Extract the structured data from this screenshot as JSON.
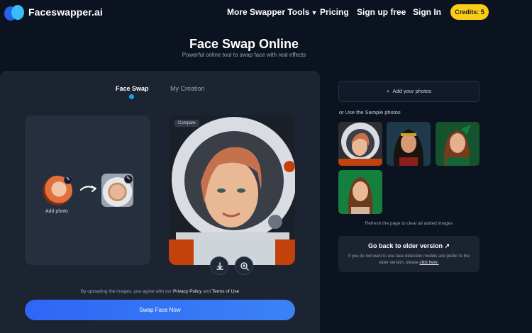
{
  "nav": {
    "brand": "Faceswapper.ai",
    "links": [
      "More Swapper Tools",
      "Pricing",
      "Sign up free",
      "Sign In"
    ],
    "credits": "Credits: 5"
  },
  "hero": {
    "title": "Face Swap Online",
    "subtitle": "Powerful online tool to swap face with real effects"
  },
  "tabs": {
    "active": "Face Swap",
    "other": "My Creation"
  },
  "upload": {
    "add_photo": "Add photo"
  },
  "result": {
    "compare": "Compare"
  },
  "disclaimer": {
    "prefix": "By uploading the images, you agree with our",
    "privacy": "Privacy Policy",
    "and": "and",
    "terms": "Terms of Use"
  },
  "actions": {
    "swap": "Swap Face Now"
  },
  "sidebar": {
    "add_photos": "Add your photos",
    "sample_label": "or Use the Sample photos",
    "refresh_note": "Refresh the page to clear all added images",
    "elder_title": "Go back to elder version ↗",
    "elder_text": "If you do not want to use face detection models and prefer to the elder version, please",
    "elder_link": "click here."
  },
  "colors": {
    "background": "#0b1220",
    "panel": "#1c2431",
    "accent": "#3b82f6",
    "credits": "#facc15"
  },
  "icons": [
    "edit-icon",
    "arrow-right-icon",
    "download-icon",
    "zoom-icon",
    "plus-icon",
    "chevron-down-icon"
  ]
}
